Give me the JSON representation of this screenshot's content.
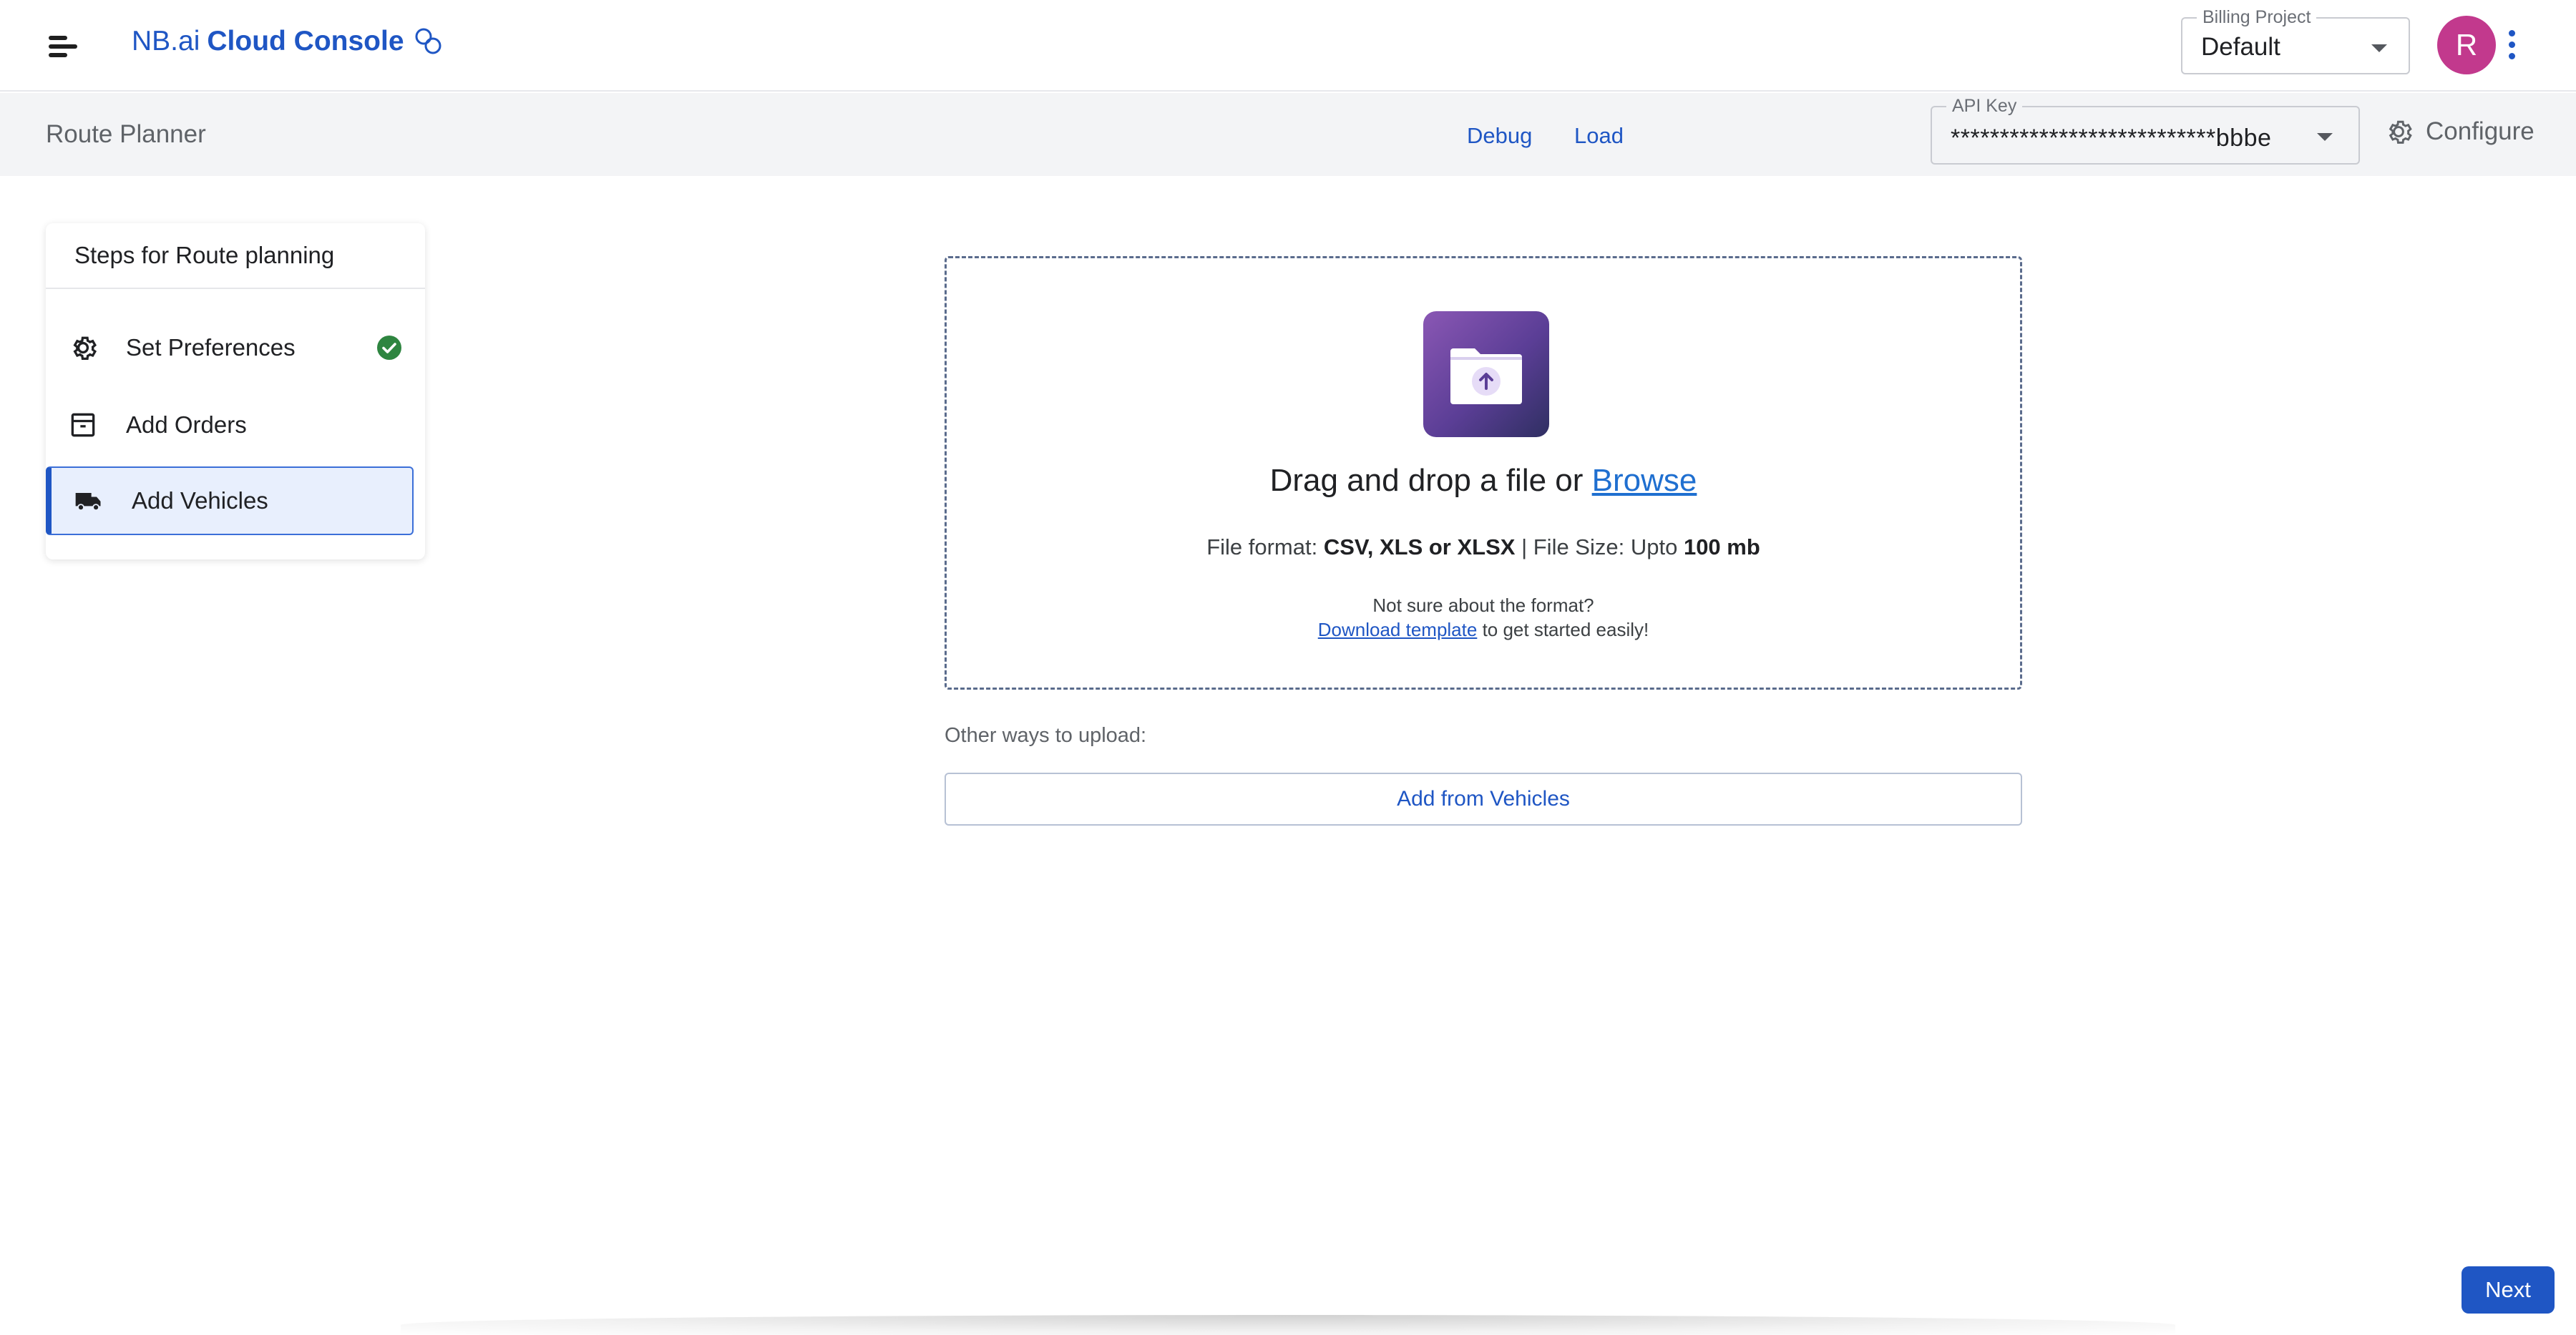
{
  "header": {
    "brand_prefix": "NB.ai",
    "brand_name": "Cloud Console",
    "billing": {
      "legend": "Billing Project",
      "value": "Default"
    },
    "avatar_initial": "R"
  },
  "subheader": {
    "title": "Route Planner",
    "links": {
      "debug": "Debug",
      "load": "Load"
    },
    "api_key": {
      "legend": "API Key",
      "value": "***************************bbbe"
    },
    "configure_label": "Configure"
  },
  "steps": {
    "heading": "Steps for Route planning",
    "items": [
      {
        "label": "Set Preferences",
        "icon": "gear-icon",
        "completed": true
      },
      {
        "label": "Add Orders",
        "icon": "archive-box-icon",
        "completed": false
      },
      {
        "label": "Add Vehicles",
        "icon": "truck-icon",
        "active": true
      }
    ]
  },
  "upload": {
    "title_prefix": "Drag and drop a file or",
    "browse_label": "Browse",
    "format_prefix": "File format:",
    "format_types": "CSV, XLS or XLSX",
    "size_prefix": "| File Size: Upto",
    "size_value": "100 mb",
    "note_line1": "Not sure about the format?",
    "template_link": "Download template",
    "note_suffix": "to get started easily!"
  },
  "other_ways": {
    "label": "Other ways to upload:",
    "button": "Add from Vehicles"
  },
  "footer": {
    "next_label": "Next"
  },
  "colors": {
    "accent": "#1f56c4",
    "avatar": "#c2398d",
    "success": "#2e8540",
    "active_bg": "#e8effd"
  }
}
